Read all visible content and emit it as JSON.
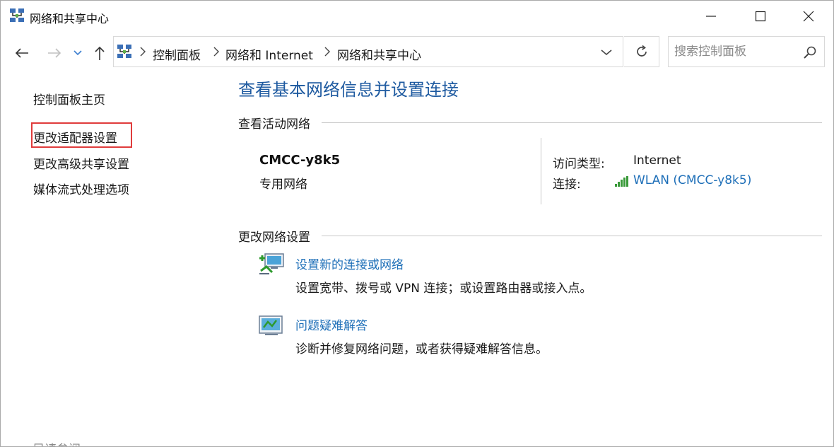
{
  "window": {
    "title": "网络和共享中心"
  },
  "address": {
    "breadcrumbs": [
      "控制面板",
      "网络和 Internet",
      "网络和共享中心"
    ]
  },
  "search": {
    "placeholder": "搜索控制面板"
  },
  "sidebar": {
    "items": [
      {
        "label": "控制面板主页"
      },
      {
        "label": "更改适配器设置",
        "highlighted": true
      },
      {
        "label": "更改高级共享设置"
      },
      {
        "label": "媒体流式处理选项"
      }
    ],
    "see_also": "另请参阅"
  },
  "main": {
    "title": "查看基本网络信息并设置连接",
    "active_section": "查看活动网络",
    "network": {
      "name": "CMCC-y8k5",
      "type": "专用网络",
      "access_label": "访问类型:",
      "access_value": "Internet",
      "connection_label": "连接:",
      "connection_value": "WLAN (CMCC-y8k5)"
    },
    "change_section": "更改网络设置",
    "tasks": [
      {
        "link": "设置新的连接或网络",
        "desc": "设置宽带、拨号或 VPN 连接；或设置路由器或接入点。",
        "icon": "network-setup-icon"
      },
      {
        "link": "问题疑难解答",
        "desc": "诊断并修复网络问题，或者获得疑难解答信息。",
        "icon": "troubleshoot-icon"
      }
    ]
  },
  "colors": {
    "link_blue": "#1e6fb8",
    "title_blue": "#1e5aa0",
    "highlight_red": "#e03c3c"
  }
}
